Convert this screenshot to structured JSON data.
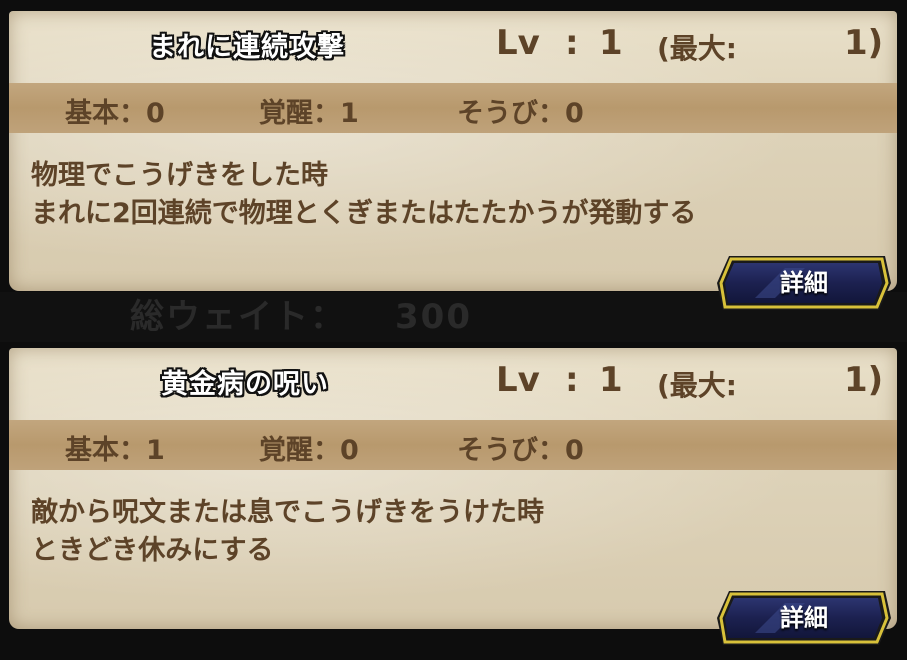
{
  "background_text": {
    "label": "総ウェイト：",
    "value": "300"
  },
  "skills": [
    {
      "name": "まれに連続攻撃",
      "level_label": "Lv",
      "level_colon": ":",
      "level_value": "1",
      "max_label": "(最大:",
      "max_value": "1)",
      "stats": {
        "base": "基本：0",
        "awaken": "覚醒：1",
        "equip": "そうび：0"
      },
      "description": [
        "物理でこうげきをした時",
        "まれに2回連続で物理とくぎまたはたたかうが発動する"
      ],
      "detail_button_label": "詳細"
    },
    {
      "name": "黄金病の呪い",
      "level_label": "Lv",
      "level_colon": ":",
      "level_value": "1",
      "max_label": "(最大:",
      "max_value": "1)",
      "stats": {
        "base": "基本：1",
        "awaken": "覚醒：0",
        "equip": "そうび：0"
      },
      "description": [
        "敵から呪文または息でこうげきをうけた時",
        "ときどき休みにする"
      ],
      "detail_button_label": "詳細"
    }
  ],
  "colors": {
    "parchment": "#e3d8bf",
    "band": "#bc9f76",
    "text_brown": "#5d4328",
    "button_navy": "#1c2150",
    "button_gold": "#d8c13a"
  }
}
